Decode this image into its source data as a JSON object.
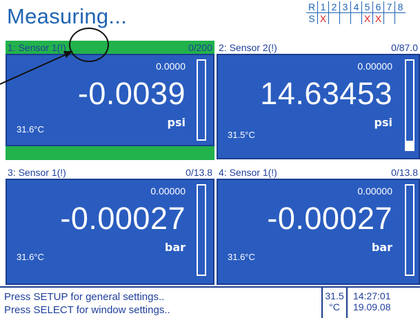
{
  "title": "Measuring...",
  "relays": {
    "row_labels": [
      "R",
      "S"
    ],
    "numbers": [
      "1",
      "2",
      "3",
      "4",
      "5",
      "6",
      "7",
      "8"
    ],
    "states": [
      "X",
      "",
      "",
      "",
      "X",
      "X",
      "",
      ""
    ]
  },
  "panels": [
    {
      "name": "1: Sensor 1(!)",
      "range": "0/200",
      "ref": "0.0000",
      "value": "-0.0039",
      "unit": "psi",
      "temp": "31.6°C",
      "active": true,
      "bar_fill_fraction": 0.0
    },
    {
      "name": "2: Sensor 2(!)",
      "range": "0/87.0",
      "ref": "0.00000",
      "value": "14.63453",
      "unit": "psi",
      "temp": "31.5°C",
      "active": false,
      "bar_fill_fraction": 0.1
    },
    {
      "name": "3: Sensor 1(!)",
      "range": "0/13.8",
      "ref": "0.00000",
      "value": "-0.00027",
      "unit": "bar",
      "temp": "31.6°C",
      "active": false,
      "bar_fill_fraction": 0.0
    },
    {
      "name": "4: Sensor 1(!)",
      "range": "0/13.8",
      "ref": "0.00000",
      "value": "-0.00027",
      "unit": "bar",
      "temp": "31.6°C",
      "active": false,
      "bar_fill_fraction": 0.0
    }
  ],
  "status": {
    "line1": "Press SETUP for general settings..",
    "line2": "Press SELECT for window settings..",
    "temp_value": "31.5",
    "temp_unit": "°C",
    "time": "14:27:01",
    "date": "19.09.08"
  },
  "colors": {
    "panel_blue": "#2a5cbf",
    "title_blue": "#1f64b3",
    "active_green": "#22b24c",
    "relay_x": "#e02020"
  }
}
